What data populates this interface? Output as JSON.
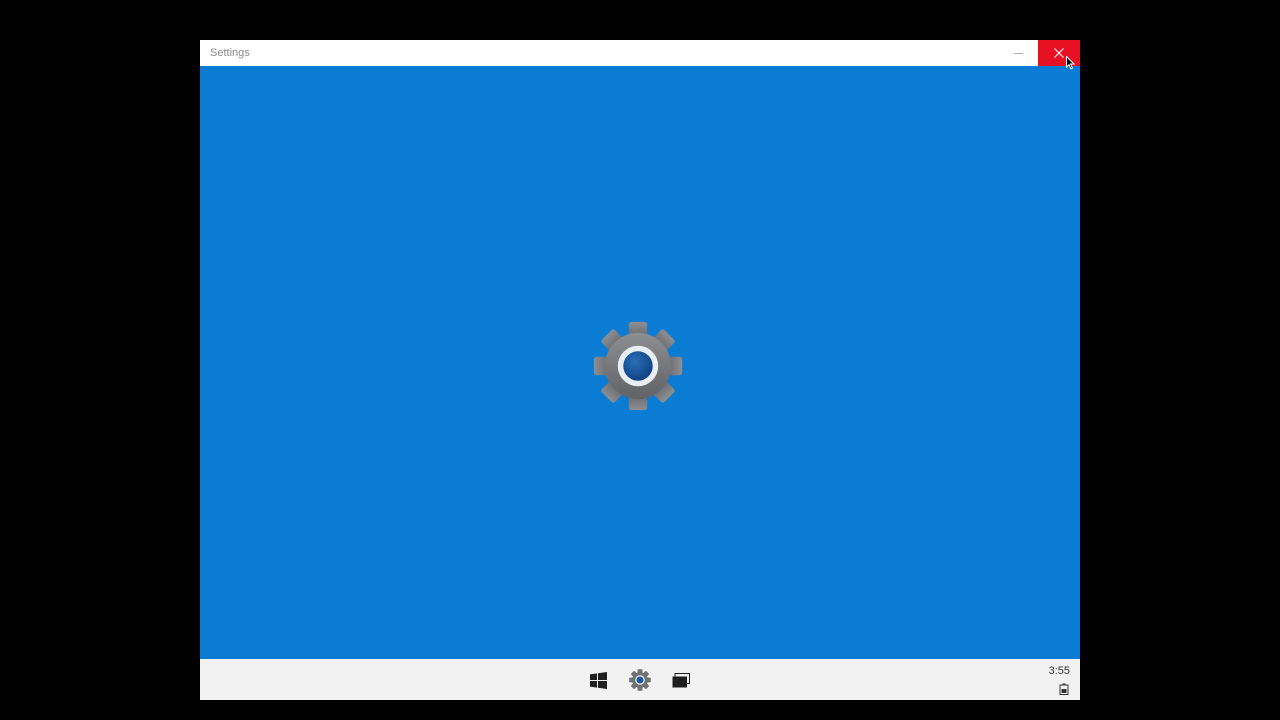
{
  "window": {
    "title": "Settings"
  },
  "splash": {
    "icon": "gear-icon"
  },
  "taskbar": {
    "buttons": [
      "windows-start-icon",
      "settings-gear-icon",
      "task-view-icon"
    ],
    "clock": "3:55",
    "tray_icon": "battery-icon"
  },
  "colors": {
    "accent": "#0a7cd3",
    "close_hover": "#e81123",
    "taskbar": "#f2f2f2"
  }
}
